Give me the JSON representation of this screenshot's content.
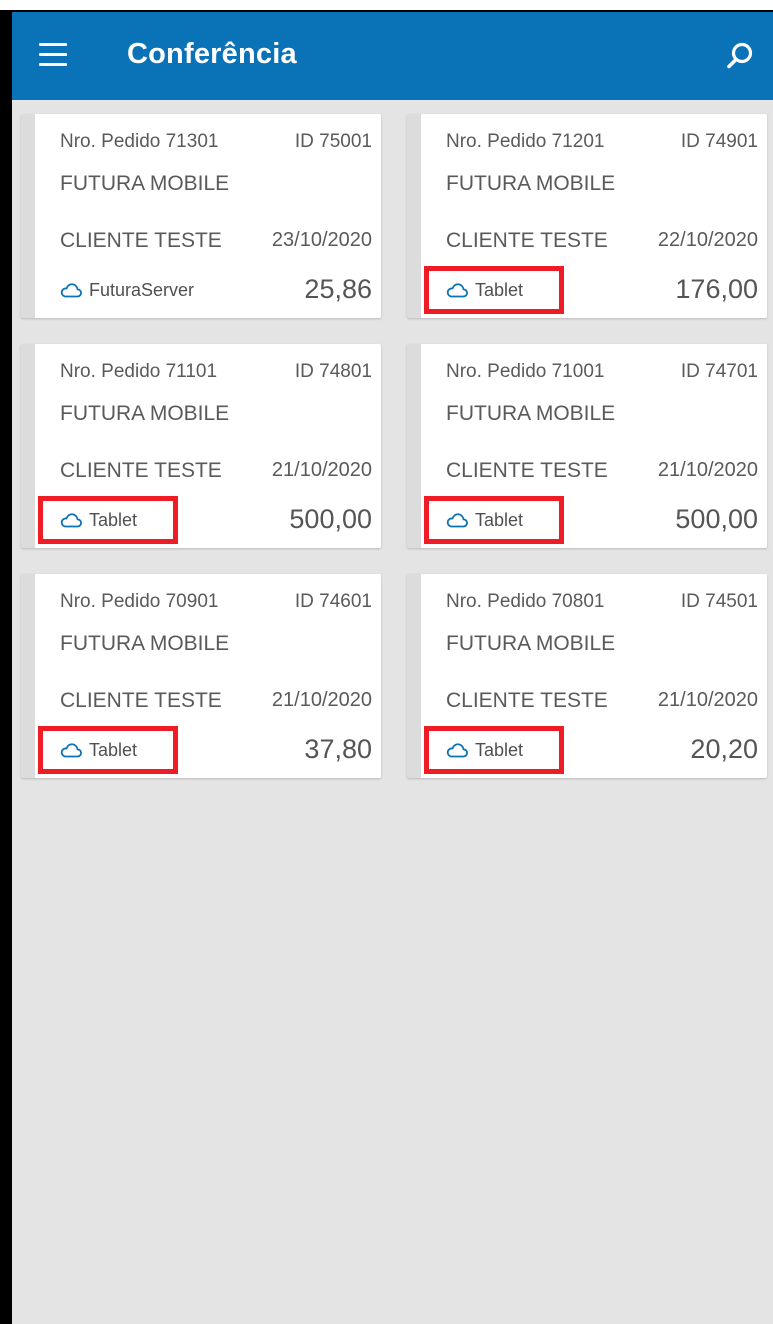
{
  "app": {
    "title": "Conferência",
    "accent_color": "#0a73b8",
    "background_color": "#e4e4e4",
    "highlight_color": "#ee1c25",
    "icons": {
      "menu": "hamburger-menu-icon",
      "search": "search-icon",
      "cloud": "cloud-icon"
    }
  },
  "orders": [
    {
      "order_label": "Nro. Pedido 71301",
      "id_label": "ID 75001",
      "company": "FUTURA MOBILE",
      "client": "CLIENTE TESTE",
      "date": "23/10/2020",
      "origin": "FuturaServer",
      "total": "25,86",
      "highlighted": false
    },
    {
      "order_label": "Nro. Pedido 71201",
      "id_label": "ID 74901",
      "company": "FUTURA MOBILE",
      "client": "CLIENTE TESTE",
      "date": "22/10/2020",
      "origin": "Tablet",
      "total": "176,00",
      "highlighted": true
    },
    {
      "order_label": "Nro. Pedido 71101",
      "id_label": "ID 74801",
      "company": "FUTURA MOBILE",
      "client": "CLIENTE TESTE",
      "date": "21/10/2020",
      "origin": "Tablet",
      "total": "500,00",
      "highlighted": true
    },
    {
      "order_label": "Nro. Pedido 71001",
      "id_label": "ID 74701",
      "company": "FUTURA MOBILE",
      "client": "CLIENTE TESTE",
      "date": "21/10/2020",
      "origin": "Tablet",
      "total": "500,00",
      "highlighted": true
    },
    {
      "order_label": "Nro. Pedido 70901",
      "id_label": "ID 74601",
      "company": "FUTURA MOBILE",
      "client": "CLIENTE TESTE",
      "date": "21/10/2020",
      "origin": "Tablet",
      "total": "37,80",
      "highlighted": true
    },
    {
      "order_label": "Nro. Pedido 70801",
      "id_label": "ID 74501",
      "company": "FUTURA MOBILE",
      "client": "CLIENTE TESTE",
      "date": "21/10/2020",
      "origin": "Tablet",
      "total": "20,20",
      "highlighted": true
    }
  ]
}
